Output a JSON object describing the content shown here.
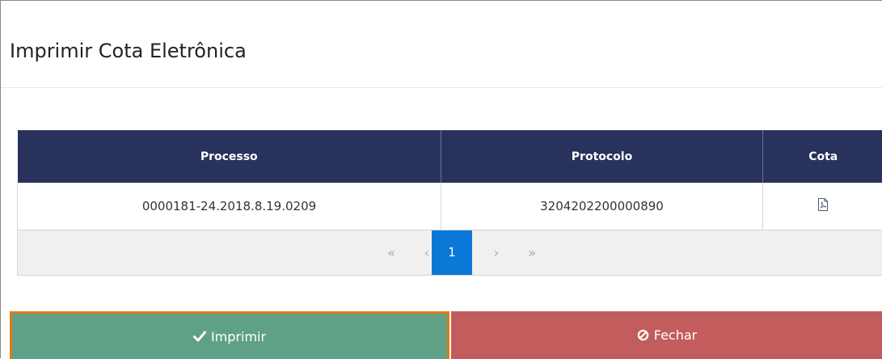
{
  "dialog": {
    "title": "Imprimir Cota Eletrônica"
  },
  "table": {
    "headers": [
      "Processo",
      "Protocolo",
      "Cota"
    ],
    "rows": [
      {
        "processo": "0000181-24.2018.8.19.0209",
        "protocolo": "3204202200000890",
        "cota_icon": "pdf-icon"
      }
    ]
  },
  "pagination": {
    "first": "«",
    "prev": "‹",
    "current_page": "1",
    "next": "›",
    "last": "»"
  },
  "buttons": {
    "print_label": "Imprimir",
    "print_icon": "check-icon",
    "close_label": "Fechar",
    "close_icon": "ban-icon"
  },
  "colors": {
    "header_bg": "#28325c",
    "print_bg": "#5fa186",
    "close_bg": "#c35c5c",
    "active_page": "#0a78d6",
    "focus_outline": "#e07a18"
  }
}
